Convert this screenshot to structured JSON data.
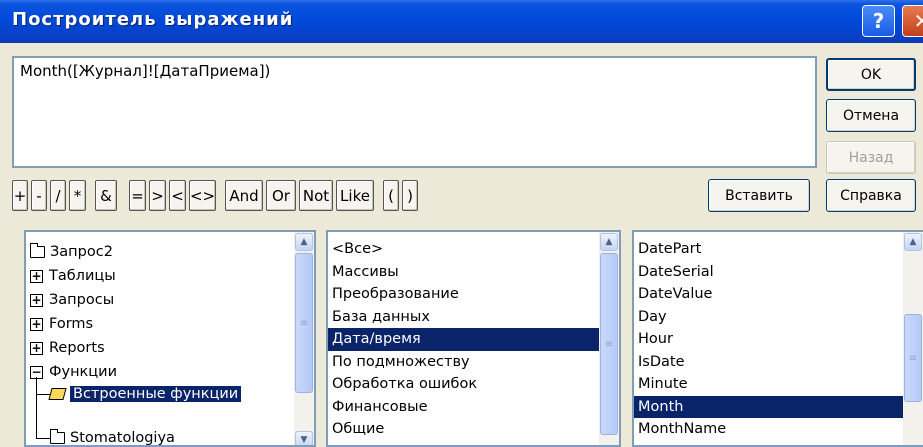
{
  "window": {
    "title": "Построитель выражений",
    "help_glyph": "?",
    "close_glyph": "✕"
  },
  "expression": {
    "value": "Month([Журнал]![ДатаПриема])"
  },
  "buttons": {
    "ok": "OK",
    "cancel": "Отмена",
    "back": "Назад",
    "paste": "Вставить",
    "help": "Справка"
  },
  "operators": [
    "+",
    "-",
    "/",
    "*",
    "&",
    "=",
    ">",
    "<",
    "<>",
    "And",
    "Or",
    "Not",
    "Like",
    "(",
    ")"
  ],
  "tree": {
    "items": [
      {
        "label": "Запрос2",
        "icon": "folder-icon"
      },
      {
        "label": "Таблицы",
        "icon": "plus-box-icon"
      },
      {
        "label": "Запросы",
        "icon": "plus-box-icon"
      },
      {
        "label": "Forms",
        "icon": "plus-box-icon"
      },
      {
        "label": "Reports",
        "icon": "plus-box-icon"
      },
      {
        "label": "Функции",
        "icon": "minus-box-icon"
      },
      {
        "label": "Встроенные функции",
        "icon": "open-folder-icon",
        "selected": true
      },
      {
        "label": "Stomatologiya",
        "icon": "folder-icon"
      }
    ]
  },
  "categories": {
    "items": [
      "<Все>",
      "Массивы",
      "Преобразование",
      "База данных",
      "Дата/время",
      "По подмножеству",
      "Обработка ошибок",
      "Финансовые",
      "Общие"
    ],
    "selected_index": 4
  },
  "functions": {
    "items": [
      "DatePart",
      "DateSerial",
      "DateValue",
      "Day",
      "Hour",
      "IsDate",
      "Minute",
      "Month",
      "MonthName"
    ],
    "selected_index": 7
  },
  "colors": {
    "title_bar": "#0048d8",
    "selection": "#0a246a",
    "dialog_bg": "#ece9d8",
    "field_border": "#7f9db9"
  }
}
